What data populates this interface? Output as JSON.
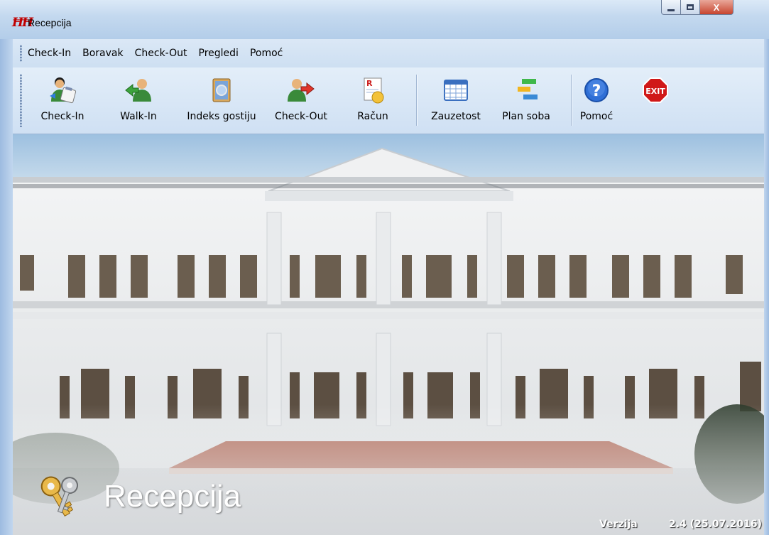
{
  "window": {
    "title": "Recepcija",
    "app_icon_glyph": "ĦĦ",
    "close_label": "X"
  },
  "menu": {
    "items": [
      "Check-In",
      "Boravak",
      "Check-Out",
      "Pregledi",
      "Pomoć"
    ]
  },
  "toolbar": {
    "buttons": [
      {
        "label": "Check-In",
        "icon": "user-with-clipboard-icon"
      },
      {
        "label": "Walk-In",
        "icon": "user-arrow-in-icon"
      },
      {
        "label": "Indeks gostiju",
        "icon": "guest-index-book-icon"
      },
      {
        "label": "Check-Out",
        "icon": "user-arrow-out-icon"
      },
      {
        "label": "Račun",
        "icon": "invoice-icon"
      },
      {
        "label": "Zauzetost",
        "icon": "calendar-grid-icon"
      },
      {
        "label": "Plan soba",
        "icon": "room-plan-bars-icon"
      },
      {
        "label": "Pomoć",
        "icon": "help-icon"
      },
      {
        "label": "",
        "icon": "exit-icon",
        "icon_text": "EXIT"
      }
    ]
  },
  "main": {
    "brand_title": "Recepcija",
    "version_label": "Verzija",
    "version_value": "2.4 (25.07.2016)"
  },
  "colors": {
    "title_bar": "#c4d9ef",
    "toolbar": "#d7e6f5",
    "close_button": "#c7442e",
    "exit_icon": "#d01818",
    "help_icon": "#2f6fd6"
  }
}
